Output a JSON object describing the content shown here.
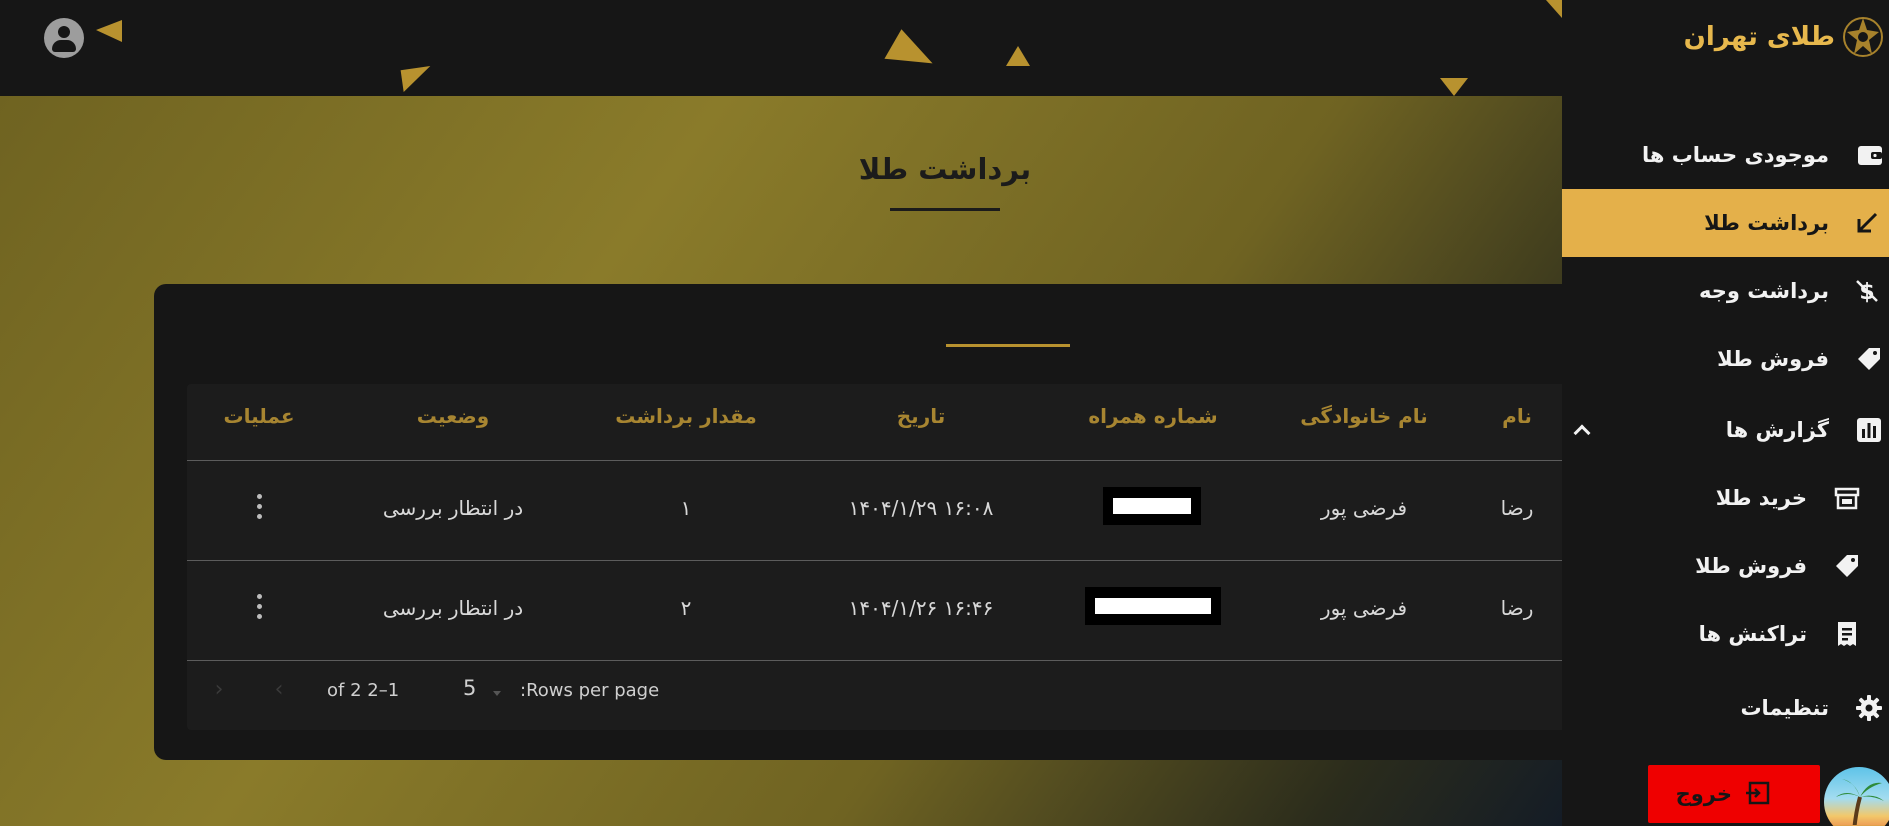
{
  "brand": {
    "name": "طلای تهران"
  },
  "page": {
    "title": "برداشت طلا"
  },
  "table": {
    "columns": {
      "first_name": "نام",
      "last_name": "نام خانوادگی",
      "phone": "شماره همراه",
      "date": "تاریخ",
      "amount": "مقدار برداشت",
      "status": "وضعیت",
      "actions": "عملیات"
    },
    "rows": [
      {
        "first_name": "رضا",
        "last_name": "فرضی پور",
        "phone": "",
        "date": "۱۶:۰۸ ۱۴۰۴/۱/۲۹",
        "amount": "۱",
        "status": "در انتظار بررسی"
      },
      {
        "first_name": "رضا",
        "last_name": "فرضی پور",
        "phone": "",
        "date": "۱۶:۴۶ ۱۴۰۴/۱/۲۶",
        "amount": "۲",
        "status": "در انتظار بررسی"
      }
    ],
    "pagination": {
      "rows_per_page_label": ":Rows per page",
      "rows_per_page": "5",
      "range": "1–2 of 2"
    }
  },
  "sidebar": {
    "items": [
      {
        "label": "موجودی حساب ها",
        "icon": "wallet-icon"
      },
      {
        "label": "برداشت طلا",
        "icon": "arrow-down-left-icon",
        "active": true
      },
      {
        "label": "برداشت وجه",
        "icon": "money-off-icon"
      },
      {
        "label": "فروش طلا",
        "icon": "tag-icon"
      },
      {
        "label": "گزارش ها",
        "icon": "bar-chart-icon",
        "expanded": true
      },
      {
        "label": "خرید طلا",
        "icon": "store-icon",
        "sub": true
      },
      {
        "label": "فروش طلا",
        "icon": "tag-icon",
        "sub": true
      },
      {
        "label": "تراکنش ها",
        "icon": "receipt-icon",
        "sub": true
      },
      {
        "label": "تنظیمات",
        "icon": "gear-icon"
      }
    ],
    "logout_label": "خروج"
  },
  "colors": {
    "accent": "#e4b04a",
    "header_text": "#a78531",
    "logout": "#ef0000",
    "sidebar_bg": "#161616"
  }
}
